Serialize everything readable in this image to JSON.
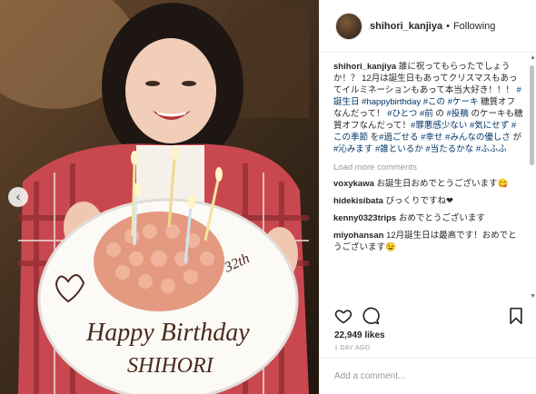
{
  "post": {
    "username": "shihori_kanjiya",
    "follow_state": "Following",
    "caption": {
      "segments": [
        {
          "t": "誰に祝ってもらったでしょうか！？ 12月は誕生日もあってクリスマスもあってイルミネーションもあって本当大好き！！！ ",
          "tag": false
        },
        {
          "t": "#誕生日",
          "tag": true
        },
        {
          "t": " ",
          "tag": false
        },
        {
          "t": "#happybirthday",
          "tag": true
        },
        {
          "t": " ",
          "tag": false
        },
        {
          "t": "#この",
          "tag": true
        },
        {
          "t": " ",
          "tag": false
        },
        {
          "t": "#ケーキ",
          "tag": true
        },
        {
          "t": " 糖質オフ なんだって！ ",
          "tag": false
        },
        {
          "t": "#ひとつ",
          "tag": true
        },
        {
          "t": " ",
          "tag": false
        },
        {
          "t": "#前",
          "tag": true
        },
        {
          "t": " の ",
          "tag": false
        },
        {
          "t": "#投稿",
          "tag": true
        },
        {
          "t": " のケーキも糖質オフなんだって！",
          "tag": false
        },
        {
          "t": "#罪悪感少ない",
          "tag": true
        },
        {
          "t": " ",
          "tag": false
        },
        {
          "t": "#気にせず",
          "tag": true
        },
        {
          "t": " ",
          "tag": false
        },
        {
          "t": "#この季節",
          "tag": true
        },
        {
          "t": " を",
          "tag": false
        },
        {
          "t": "#過ごせる",
          "tag": true
        },
        {
          "t": " ",
          "tag": false
        },
        {
          "t": "#幸せ",
          "tag": true
        },
        {
          "t": " ",
          "tag": false
        },
        {
          "t": "#みんなの優しさ",
          "tag": true
        },
        {
          "t": " が ",
          "tag": false
        },
        {
          "t": "#沁みます",
          "tag": true
        },
        {
          "t": " ",
          "tag": false
        },
        {
          "t": "#誰といるか",
          "tag": true
        },
        {
          "t": " ",
          "tag": false
        },
        {
          "t": "#当たるかな",
          "tag": true
        },
        {
          "t": " ",
          "tag": false
        },
        {
          "t": "#ふふふ",
          "tag": true
        }
      ]
    },
    "load_more_label": "Load more comments",
    "comments": [
      {
        "user": "voxykawa",
        "text": "お誕生日おめでとうございます😋"
      },
      {
        "user": "hidekisibata",
        "text": "びっくりですね❤"
      },
      {
        "user": "kenny0323trips",
        "text": "おめでとうございます"
      },
      {
        "user": "miyohansan",
        "text": "12月誕生日は最高です！おめでとうございます😉"
      }
    ],
    "likes": "22,949 likes",
    "time": "1 DAY AGO",
    "add_comment_placeholder": "Add a comment..."
  },
  "photo": {
    "plate_text_1": "32th",
    "plate_text_2": "Happy Birthday",
    "plate_text_3": "SHIHORI"
  },
  "colors": {
    "hashtag": "#003569",
    "muted": "#999999",
    "border": "#efefef"
  },
  "icons": [
    "heart-icon",
    "comment-icon",
    "bookmark-icon",
    "chevron-left-icon"
  ]
}
